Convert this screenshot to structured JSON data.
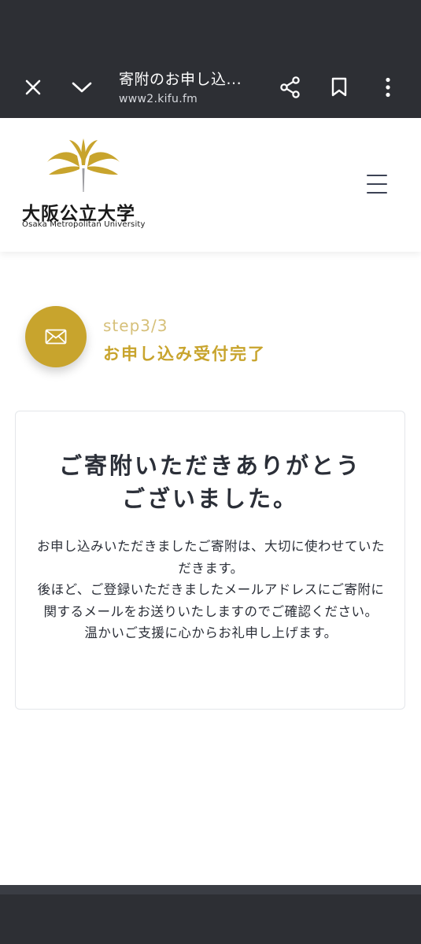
{
  "browser": {
    "title": "寄附のお申し込...",
    "url": "www2.kifu.fm"
  },
  "site": {
    "logo_name": "大阪公立大学",
    "logo_subtitle": "Osaka Metropolitan University"
  },
  "step": {
    "number": "step3/3",
    "title": "お申し込み受付完了"
  },
  "message": {
    "title_line1": "ご寄附いただきありがとう",
    "title_line2": "ございました。",
    "body_line1": "お申し込みいただきましたご寄附は、大切に使わせていただきます。",
    "body_line2": "後ほど、ご登録いただきましたメールアドレスにご寄附に関するメールをお送りいたしますのでご確認ください。",
    "body_line3": "温かいご支援に心からお礼申し上げます。"
  },
  "colors": {
    "chrome": "#2d2f34",
    "accent_gold": "#c8a42d",
    "text": "#2b2f38"
  },
  "icons": {
    "close": "close-icon",
    "chevron": "chevron-down-icon",
    "share": "share-icon",
    "bookmark": "bookmark-icon",
    "more": "more-vert-icon",
    "menu": "hamburger-menu-icon",
    "mail": "mail-icon"
  }
}
